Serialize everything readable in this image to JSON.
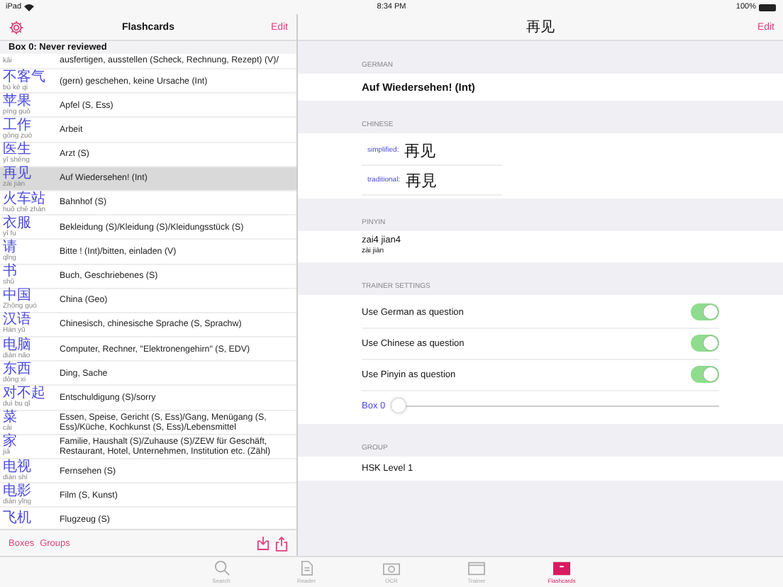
{
  "status_bar": {
    "device": "iPad",
    "time": "8:34 PM",
    "battery": "100%"
  },
  "list_pane": {
    "title": "Flashcards",
    "edit": "Edit",
    "section": "Box 0:  Never reviewed",
    "rows": [
      {
        "hanzi": "",
        "pinyin": "kāi",
        "meaning": "ausfertigen, ausstellen (Scheck, Rechnung, Rezept) (V)/",
        "selected": false
      },
      {
        "hanzi": "不客气",
        "pinyin": "bù kè qi",
        "meaning": "(gern) geschehen, keine Ursache (Int)",
        "selected": false
      },
      {
        "hanzi": "苹果",
        "pinyin": "píng guǒ",
        "meaning": "Apfel (S, Ess)",
        "selected": false
      },
      {
        "hanzi": "工作",
        "pinyin": "gōng zuò",
        "meaning": "Arbeit",
        "selected": false
      },
      {
        "hanzi": "医生",
        "pinyin": "yī shēng",
        "meaning": "Arzt (S)",
        "selected": false
      },
      {
        "hanzi": "再见",
        "pinyin": "zài jiàn",
        "meaning": "Auf Wiedersehen! (Int)",
        "selected": true
      },
      {
        "hanzi": "火车站",
        "pinyin": "huǒ chē zhàn",
        "meaning": "Bahnhof (S)",
        "selected": false
      },
      {
        "hanzi": "衣服",
        "pinyin": "yī fu",
        "meaning": "Bekleidung (S)/Kleidung (S)/Kleidungsstück (S)",
        "selected": false
      },
      {
        "hanzi": "请",
        "pinyin": "qǐng",
        "meaning": "Bitte ! (Int)/bitten, einladen (V)",
        "selected": false
      },
      {
        "hanzi": "书",
        "pinyin": "shū",
        "meaning": "Buch, Geschriebenes (S)",
        "selected": false
      },
      {
        "hanzi": "中国",
        "pinyin": "Zhōng guó",
        "meaning": "China (Geo)",
        "selected": false
      },
      {
        "hanzi": "汉语",
        "pinyin": "Hàn yǔ",
        "meaning": "Chinesisch,  chinesische Sprache (S, Sprachw)",
        "selected": false
      },
      {
        "hanzi": "电脑",
        "pinyin": "diàn nǎo",
        "meaning": "Computer, Rechner, \"Elektronengehirn\" (S, EDV)",
        "selected": false
      },
      {
        "hanzi": "东西",
        "pinyin": "dōng xi",
        "meaning": "Ding, Sache",
        "selected": false
      },
      {
        "hanzi": "对不起",
        "pinyin": "duì bu qǐ",
        "meaning": "Entschuldigung (S)/sorry",
        "selected": false
      },
      {
        "hanzi": "菜",
        "pinyin": "cài",
        "meaning": "Essen, Speise, Gericht (S, Ess)/Gang, Menügang (S, Ess)/Küche, Kochkunst (S, Ess)/Lebensmittel",
        "selected": false
      },
      {
        "hanzi": "家",
        "pinyin": "jiā",
        "meaning": "Familie, Haushalt (S)/Zuhause (S)/ZEW für Geschäft, Restaurant, Hotel, Unternehmen, Institution etc. (Zähl)",
        "selected": false
      },
      {
        "hanzi": "电视",
        "pinyin": "diàn shì",
        "meaning": "Fernsehen (S)",
        "selected": false
      },
      {
        "hanzi": "电影",
        "pinyin": "diàn yǐng",
        "meaning": "Film (S, Kunst)",
        "selected": false
      },
      {
        "hanzi": "飞机",
        "pinyin": "",
        "meaning": "Flugzeug (S)",
        "selected": false
      }
    ],
    "toolbar": {
      "boxes": "Boxes",
      "groups": "Groups"
    }
  },
  "detail": {
    "title": "再见",
    "edit": "Edit",
    "german_header": "GERMAN",
    "german": "Auf Wiedersehen! (Int)",
    "chinese_header": "CHINESE",
    "simplified_label": "simplified:",
    "simplified": "再见",
    "traditional_label": "traditional:",
    "traditional": "再見",
    "pinyin_header": "PINYIN",
    "pinyin_numbered": "zai4 jian4",
    "pinyin_marked": "zài jiàn",
    "trainer_header": "TRAINER SETTINGS",
    "toggles": [
      {
        "label": "Use German as question",
        "on": true
      },
      {
        "label": "Use Chinese as question",
        "on": true
      },
      {
        "label": "Use Pinyin as question",
        "on": true
      }
    ],
    "box_slider": {
      "label": "Box 0",
      "level": 0
    },
    "group_header": "GROUP",
    "group": "HSK Level 1"
  },
  "tab_bar": [
    {
      "label": "Search",
      "kind": "search",
      "selected": false
    },
    {
      "label": "Reader",
      "kind": "reader",
      "selected": false
    },
    {
      "label": "OCR",
      "kind": "ocr",
      "selected": false
    },
    {
      "label": "Trainer",
      "kind": "trainer",
      "selected": false
    },
    {
      "label": "Flashcards",
      "kind": "flashcards",
      "selected": true
    }
  ]
}
